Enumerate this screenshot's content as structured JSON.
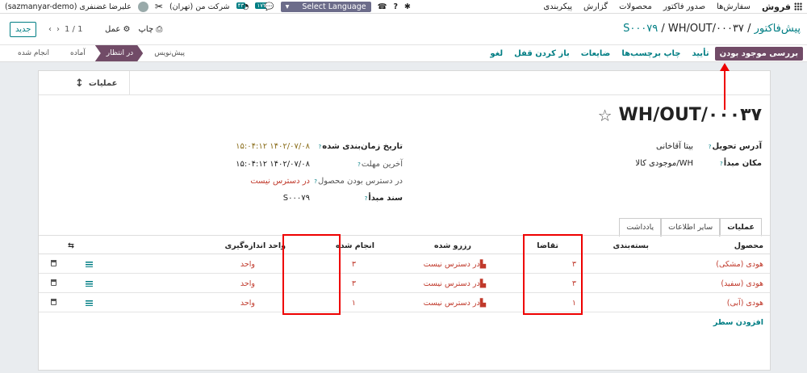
{
  "topbar": {
    "brand": "فروش",
    "menu": [
      "سفارش‌ها",
      "صدور فاکتور",
      "محصولات",
      "گزارش",
      "پیکربندی"
    ],
    "language": "Select Language",
    "badge_chat": "۱۷۴",
    "badge_activity": "۴۳",
    "company": "شرکت من (تهران)",
    "user": "علیرضا غضنفری (sazmanyar-demo)"
  },
  "control": {
    "breadcrumb_parent": "پیش‌فاکتور",
    "breadcrumb_sep1": "/",
    "breadcrumb_so": "S۰۰۰۷۹",
    "breadcrumb_sep2": "/",
    "breadcrumb_current": "WH/OUT/۰۰۰۳۷",
    "print": "چاپ",
    "action": "عمل",
    "pager": "1 / 1",
    "new_button": "جدید"
  },
  "actionbar": {
    "check_availability": "بررسی موجود بودن",
    "confirm": "تأیید",
    "print_labels": "چاپ برچسب‌ها",
    "scrap": "ضایعات",
    "unlock": "باز کردن قفل",
    "cancel": "لغو",
    "stages": [
      "پیش‌نویس",
      "در انتظار",
      "آماده",
      "انجام شده"
    ],
    "active_stage": "در انتظار"
  },
  "sheet": {
    "operations": "عملیات",
    "title": "WH/OUT/۰۰۰۳۷",
    "fields": {
      "delivery_address_label": "آدرس تحویل",
      "delivery_address": "بیتا آقاخانی",
      "source_location_label": "مکان مبدأ",
      "source_location": "WH/موجودی کالا",
      "scheduled_date_label": "تاریخ زمان‌بندی شده",
      "scheduled_date": "۱۴۰۲/۰۷/۰۸ ۱۵:۰۴:۱۲",
      "deadline_label": "آخرین مهلت",
      "deadline": "۱۴۰۲/۰۷/۰۸ ۱۵:۰۴:۱۲",
      "availability_label": "در دسترس بودن محصول",
      "availability": "در دسترس نیست",
      "source_doc_label": "سند مبدأ",
      "source_doc": "S۰۰۰۷۹"
    },
    "tabs": [
      "عملیات",
      "سایر اطلاعات",
      "یادداشت"
    ],
    "columns": [
      "محصول",
      "بسته‌بندی",
      "تقاضا",
      "رزرو شده",
      "انجام شده",
      "واحد اندازه‌گیری"
    ],
    "rows": [
      {
        "product": "هودی (مشکی)",
        "demand": "۳",
        "reserved": "در دسترس نیست",
        "done": "۳",
        "uom": "واحد"
      },
      {
        "product": "هودی (سفید)",
        "demand": "۳",
        "reserved": "در دسترس نیست",
        "done": "۳",
        "uom": "واحد"
      },
      {
        "product": "هودی (آبی)",
        "demand": "۱",
        "reserved": "در دسترس نیست",
        "done": "۱",
        "uom": "واحد"
      }
    ],
    "add_line": "افزودن سطر"
  }
}
